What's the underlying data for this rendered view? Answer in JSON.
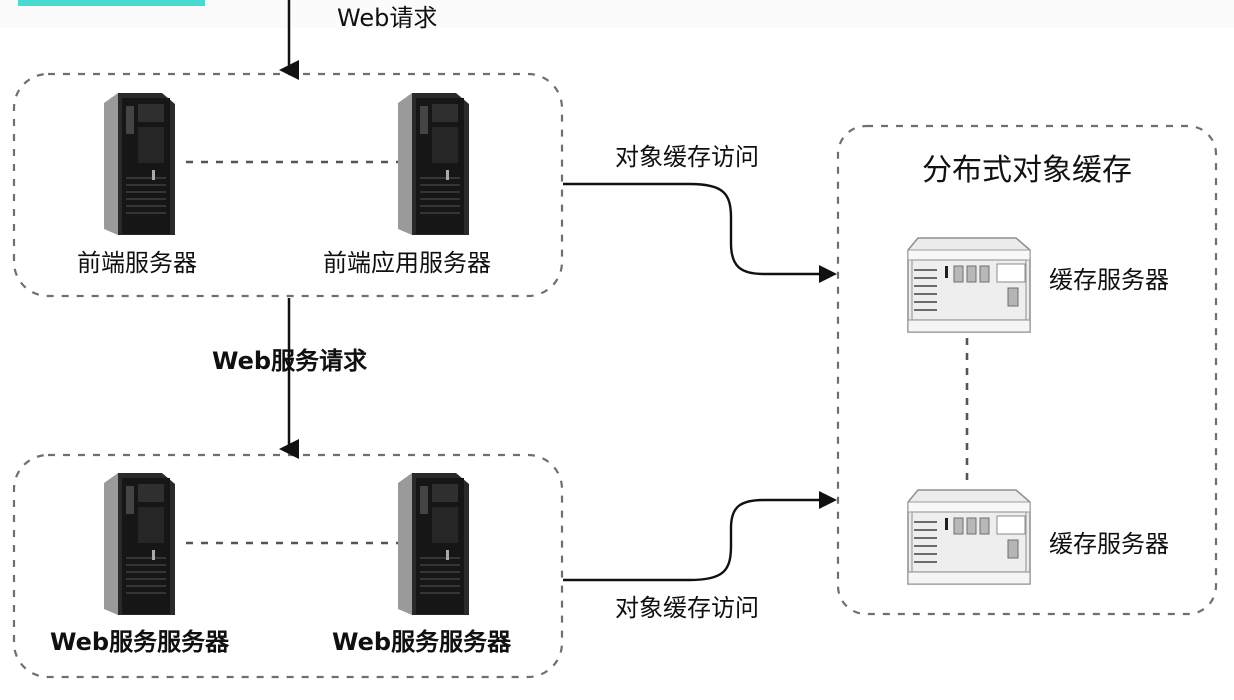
{
  "labels": {
    "web_request": "Web请求",
    "web_service_request": "Web服务请求",
    "object_cache_access_top": "对象缓存访问",
    "object_cache_access_bottom": "对象缓存访问",
    "distributed_object_cache": "分布式对象缓存"
  },
  "front_group": {
    "server_1": "前端服务器",
    "server_2": "前端应用服务器"
  },
  "web_group": {
    "server_1": "Web服务服务器",
    "server_2": "Web服务服务器"
  },
  "cache_group": {
    "server_1": "缓存服务器",
    "server_2": "缓存服务器"
  },
  "colors": {
    "accent": "#3fd7cd",
    "stroke": "#111111",
    "dash": "#7a7a7a",
    "server_dark": "#1b1b1b",
    "cache_light": "#ececec"
  },
  "icons": {
    "tower_server": "tower-server-icon",
    "cache_server": "cache-server-icon"
  }
}
